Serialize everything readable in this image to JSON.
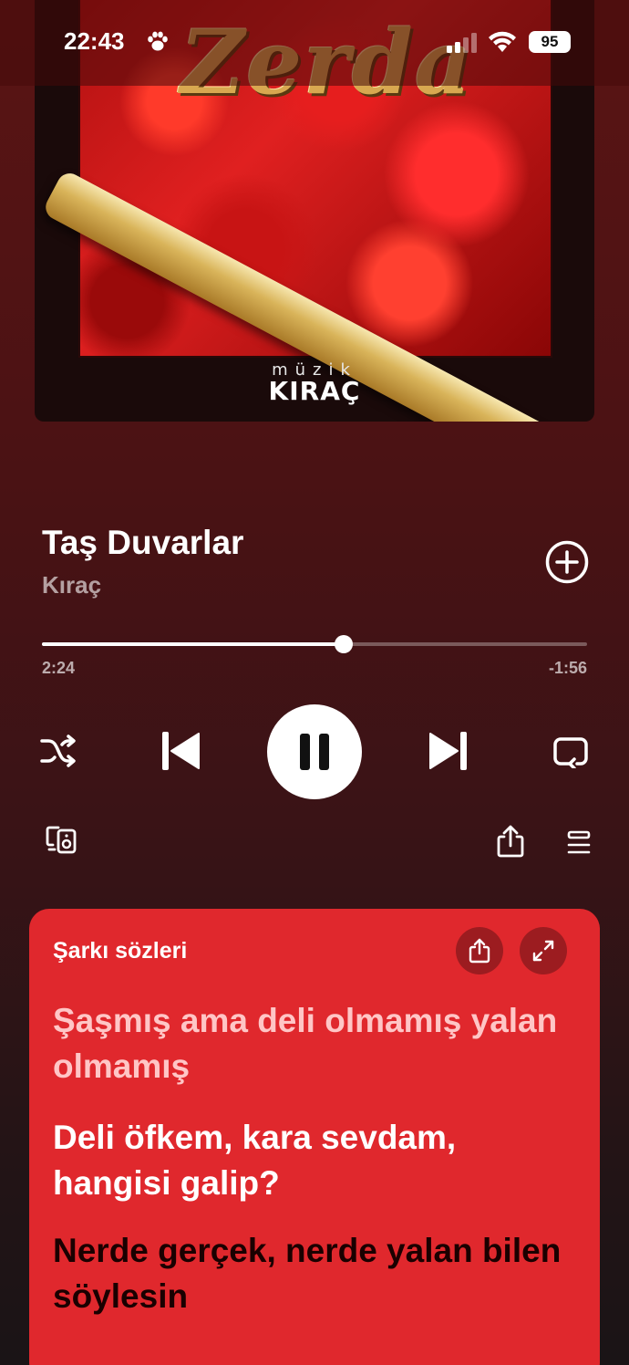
{
  "status_bar": {
    "time": "22:43",
    "battery": "95"
  },
  "album": {
    "art_title": "Zerda",
    "brand_small": "müzik",
    "brand": "KIRAÇ"
  },
  "track": {
    "title": "Taş Duvarlar",
    "artist": "Kıraç"
  },
  "progress": {
    "elapsed": "2:24",
    "remaining": "-1:56",
    "fraction": 0.553
  },
  "lyrics": {
    "header": "Şarkı sözleri",
    "lines": [
      "Şaşmış ama deli olmamış yalan olmamış",
      "Deli öfkem, kara sevdam, hangisi galip?",
      "Nerde gerçek, nerde yalan bilen söylesin"
    ]
  },
  "colors": {
    "lyrics_card": "#e0282d",
    "lyrics_button": "#9c1c20",
    "background_top": "#5a1414"
  },
  "icons": {
    "paw": "paw-icon",
    "signal": "cellular-signal-icon",
    "wifi": "wifi-icon",
    "add": "plus-circle-icon",
    "shuffle": "shuffle-icon",
    "previous": "skip-previous-icon",
    "pause": "pause-icon",
    "next": "skip-next-icon",
    "repeat": "repeat-icon",
    "devices": "connect-devices-icon",
    "share": "share-icon",
    "queue": "queue-icon",
    "expand": "expand-icon"
  }
}
